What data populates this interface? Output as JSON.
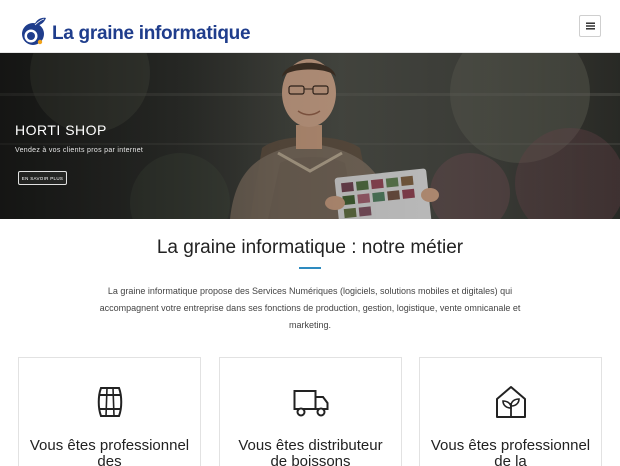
{
  "header": {
    "logo_text": "La graine informatique",
    "menu_icon": "hamburger-menu-icon"
  },
  "hero": {
    "title": "HORTI SHOP",
    "subtitle": "Vendez à vos clients pros par internet",
    "button_label": "EN SAVOIR PLUS"
  },
  "about": {
    "title": "La graine informatique : notre métier",
    "text": "La graine informatique propose des Services Numériques (logiciels, solutions mobiles et digitales) qui accompagnent votre entreprise dans ses fonctions de production, gestion, logistique, vente omnicanale et marketing."
  },
  "cards": [
    {
      "label": "Vous êtes professionnel des",
      "icon": "barrel-icon"
    },
    {
      "label": "Vous êtes distributeur de boissons",
      "icon": "truck-icon"
    },
    {
      "label": "Vous êtes professionnel de la",
      "icon": "greenhouse-plant-icon"
    }
  ],
  "colors": {
    "brand_blue": "#1f3d8c",
    "brand_orange": "#f2a31a",
    "accent_line": "#2e8bc0"
  }
}
